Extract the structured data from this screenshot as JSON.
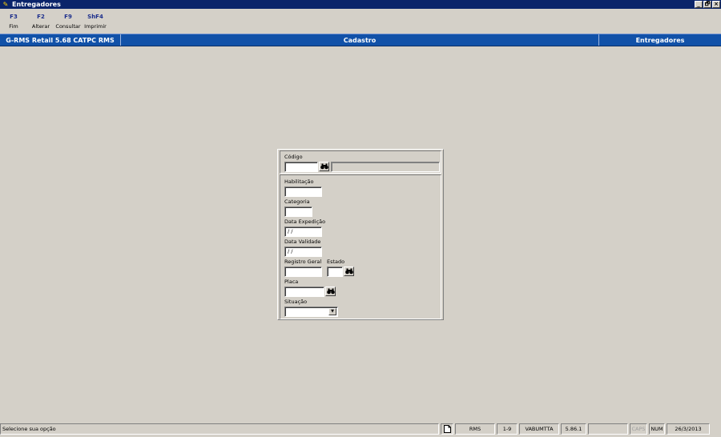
{
  "window": {
    "title": "Entregadores",
    "controls": [
      "_",
      "🗗",
      "×"
    ]
  },
  "toolbar": [
    {
      "key": "F3",
      "label": "Fim"
    },
    {
      "key": "F2",
      "label": "Alterar"
    },
    {
      "key": "F9",
      "label": "Consultar"
    },
    {
      "key": "ShF4",
      "label": "Imprimir"
    }
  ],
  "header": {
    "system": "G-RMS Retail 5.68 CATPC RMS",
    "module": "Cadastro",
    "screen": "Entregadores"
  },
  "form": {
    "codigo": {
      "label": "Código",
      "value": "",
      "description": ""
    },
    "habilitacao": {
      "label": "Habilitação",
      "value": ""
    },
    "categoria": {
      "label": "Categoria",
      "value": ""
    },
    "data_expedicao": {
      "label": "Data Expedição",
      "value": " /  /"
    },
    "data_validade": {
      "label": "Data Validade",
      "value": " /  /"
    },
    "registro_geral": {
      "label": "Registro Geral",
      "value": ""
    },
    "estado": {
      "label": "Estado",
      "value": ""
    },
    "placa": {
      "label": "Placa",
      "value": ""
    },
    "situacao": {
      "label": "Situação",
      "value": ""
    }
  },
  "icons": {
    "lookup": "binoculars-icon",
    "dropdown": "chevron-down-icon"
  },
  "status": {
    "message": "Selecione sua opção",
    "system": "RMS",
    "range": "1-9",
    "user": "VABUMTTA",
    "version": "5.86.1",
    "empty": "",
    "caps": "CAPS",
    "num": "NUM",
    "date": "26/3/2013"
  },
  "colors": {
    "title_bar": "#0a246a",
    "header_band": "#1151a8",
    "background": "#d4d0c8",
    "toolbar_key": "#1c2e8c"
  }
}
